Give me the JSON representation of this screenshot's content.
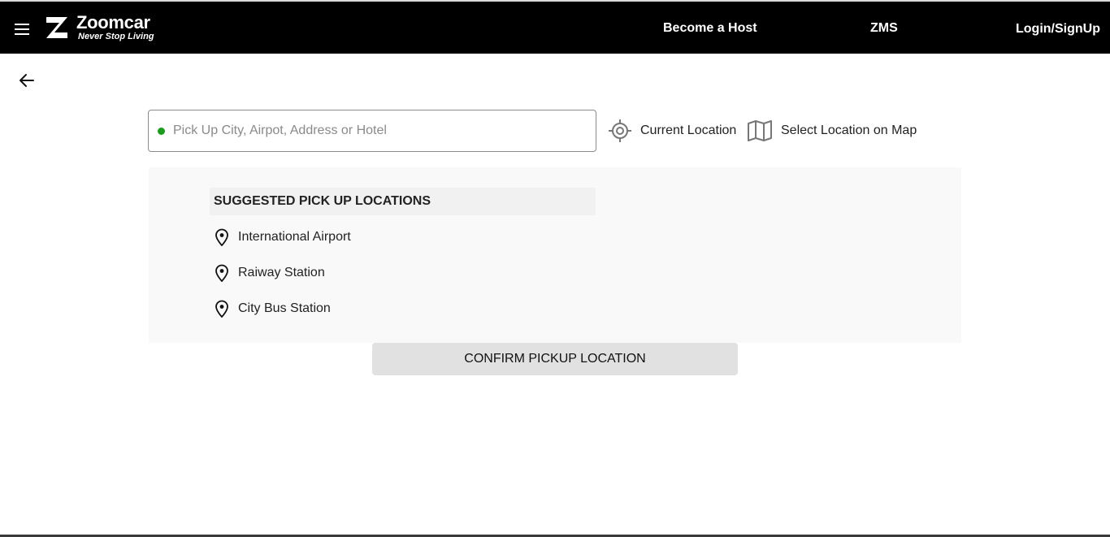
{
  "header": {
    "brand_name": "Zoomcar",
    "brand_tagline": "Never Stop Living",
    "nav": {
      "become_host": "Become a Host",
      "zms": "ZMS",
      "login": "Login/SignUp"
    }
  },
  "search": {
    "value": "",
    "placeholder": "Pick Up City, Airpot, Address or Hotel",
    "status_color": "#1e9a1e"
  },
  "options": {
    "current_location": "Current Location",
    "map_location": "Select Location on Map"
  },
  "suggestions": {
    "heading": "SUGGESTED PICK UP LOCATIONS",
    "items": [
      {
        "label": "International Airport",
        "icon": "location-pin-icon"
      },
      {
        "label": "Raiway Station",
        "icon": "location-pin-icon"
      },
      {
        "label": "City Bus Station",
        "icon": "location-pin-icon"
      }
    ]
  },
  "confirm_label": "CONFIRM PICKUP LOCATION",
  "colors": {
    "header_bg": "#000000",
    "panel_bg": "#f9f9f9",
    "button_bg": "#e1e1e1"
  }
}
